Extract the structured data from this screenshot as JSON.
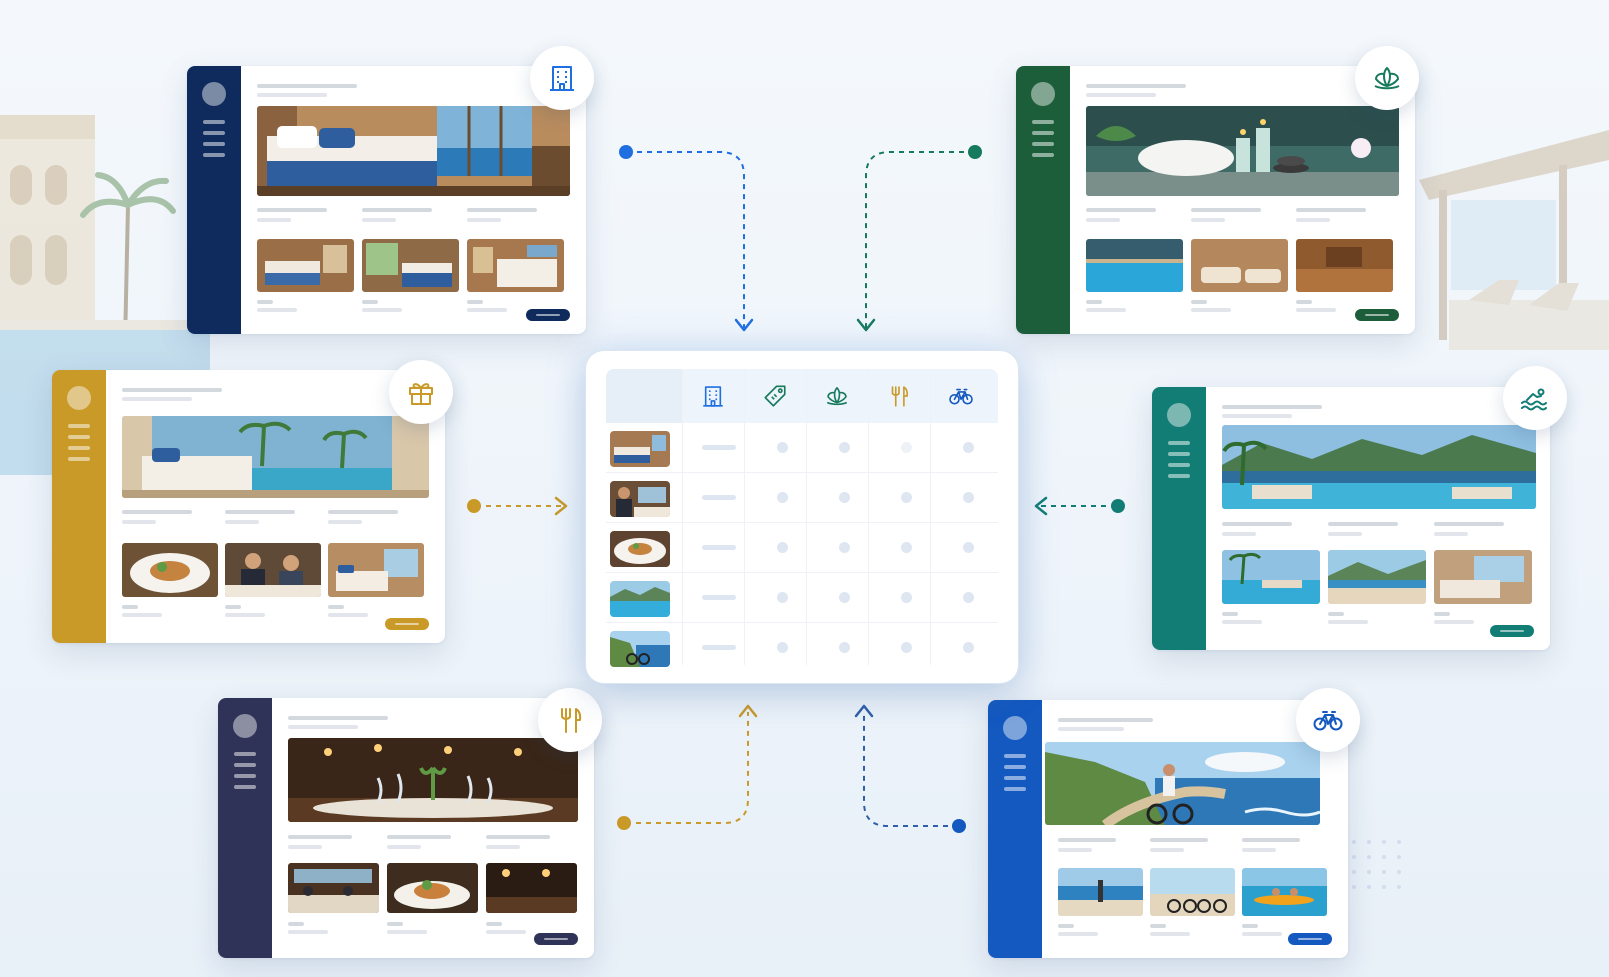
{
  "colors": {
    "hotel": "#0f2a5c",
    "spa": "#1d5e3a",
    "offers": "#c99a28",
    "pool": "#117d74",
    "dining": "#2f3357",
    "activities": "#1459c0",
    "accent_blue": "#1f6fe0",
    "accent_green": "#167a5c",
    "accent_gold": "#c99a28"
  },
  "panels": [
    {
      "id": "hotel-rooms",
      "icon": "building-icon",
      "color": "#0f2a5c"
    },
    {
      "id": "spa-wellness",
      "icon": "lotus-icon",
      "color": "#1d5e3a"
    },
    {
      "id": "offers-packages",
      "icon": "gift-icon",
      "color": "#c99a28"
    },
    {
      "id": "pool-beach",
      "icon": "swimming-icon",
      "color": "#117d74"
    },
    {
      "id": "dining",
      "icon": "fork-knife-icon",
      "color": "#2f3357"
    },
    {
      "id": "activities",
      "icon": "bicycle-icon",
      "color": "#1459c0"
    }
  ],
  "matrix": {
    "columns": [
      "building-icon",
      "tag-icon",
      "lotus-icon",
      "fork-knife-icon",
      "bicycle-icon"
    ],
    "rows": [
      "room-thumb",
      "dining-guest-thumb",
      "food-thumb",
      "pool-thumb",
      "cycling-thumb"
    ]
  }
}
